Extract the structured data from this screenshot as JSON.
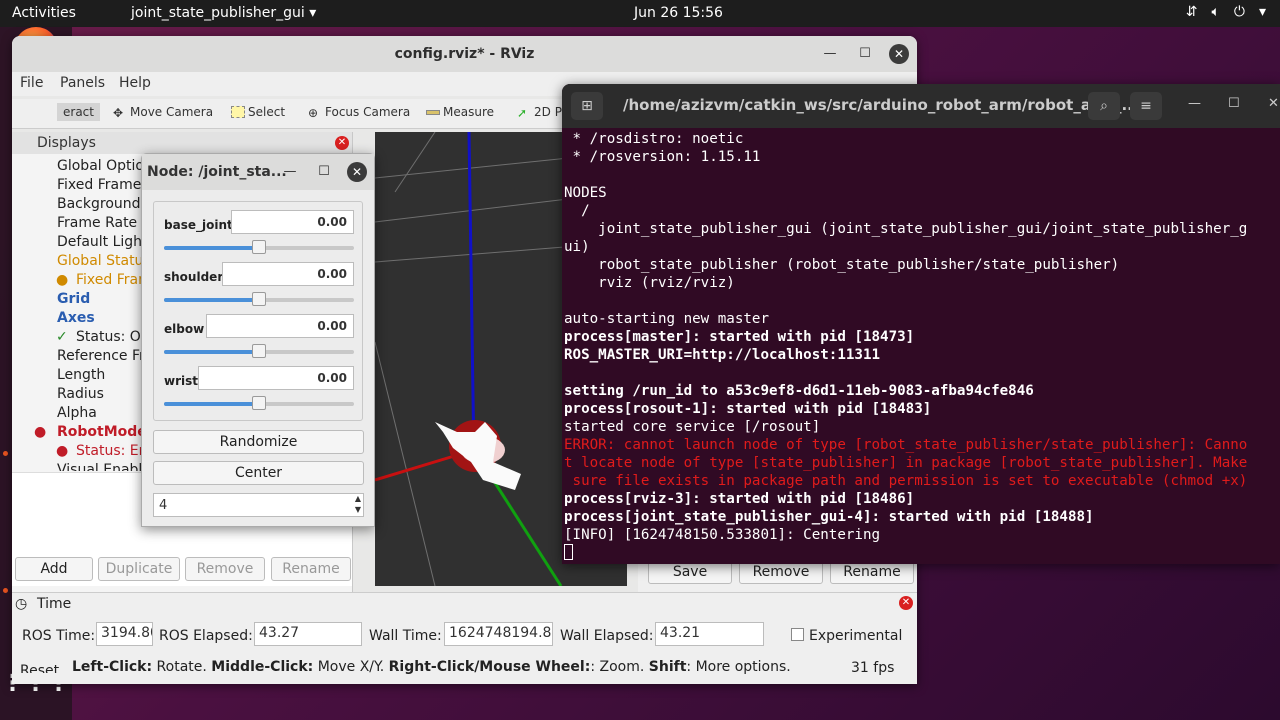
{
  "topbar": {
    "activities": "Activities",
    "app_name": "joint_state_publisher_gui",
    "clock": "Jun 26  15:56",
    "tray_icons": [
      "network-icon",
      "volume-icon",
      "power-icon",
      "chevron-down-icon"
    ]
  },
  "dock": {
    "apps": [
      "firefox-icon",
      "thunderbird-icon",
      "files-icon",
      "rhythmbox-icon",
      "writer-icon",
      "software-icon",
      "terminal-icon",
      "help-icon",
      "app-grid-icon"
    ]
  },
  "rviz": {
    "title": "config.rviz* - RViz",
    "menu": [
      "File",
      "Panels",
      "Help"
    ],
    "tools": [
      "eract",
      "Move Camera",
      "Select",
      "Focus Camera",
      "Measure",
      "2D Pe"
    ],
    "displays_header": "Displays",
    "display_items": [
      "Global Optio",
      "Fixed Frame",
      "Background",
      "Frame Rate",
      "Default Light",
      "Global Status",
      "Fixed Fran",
      "Grid",
      "Axes",
      "Status: Ol",
      "Reference Fr",
      "Length",
      "Radius",
      "Alpha",
      "RobotMode",
      "Status: Er",
      "Visual Enable"
    ],
    "buttons": {
      "add": "Add",
      "duplicate": "Duplicate",
      "remove": "Remove",
      "rename": "Rename"
    },
    "views_buttons": {
      "save": "Save",
      "remove": "Remove",
      "rename": "Rename"
    },
    "time_panel": {
      "header": "Time",
      "ros_time_label": "ROS Time:",
      "ros_time": "3194.80",
      "ros_elapsed_label": "ROS Elapsed:",
      "ros_elapsed": "43.27",
      "wall_time_label": "Wall Time:",
      "wall_time": "1624748194.84",
      "wall_elapsed_label": "Wall Elapsed:",
      "wall_elapsed": "43.21",
      "experimental_label": "Experimental",
      "reset": "Reset"
    },
    "status_bar": {
      "left_click": "Left-Click:",
      "rotate": "Rotate.",
      "middle_click": "Middle-Click:",
      "move": "Move X/Y.",
      "right_click": "Right-Click/Mouse Wheel:",
      "zoom": ": Zoom.",
      "shift": "Shift",
      "more": ": More options.",
      "fps": "31 fps"
    }
  },
  "node_dialog": {
    "title": "Node: /joint_sta...",
    "joints": [
      {
        "name": "base_joint",
        "value": "0.00",
        "position": 0.5
      },
      {
        "name": "shoulder",
        "value": "0.00",
        "position": 0.5
      },
      {
        "name": "elbow",
        "value": "0.00",
        "position": 0.5
      },
      {
        "name": "wrist",
        "value": "0.00",
        "position": 0.5
      }
    ],
    "randomize": "Randomize",
    "center": "Center",
    "spin_value": "4"
  },
  "terminal": {
    "title": "/home/azizvm/catkin_ws/src/arduino_robot_arm/robot_arm_...",
    "lines": [
      {
        "text": " * /rosdistro: noetic",
        "style": ""
      },
      {
        "text": " * /rosversion: 1.15.11",
        "style": ""
      },
      {
        "text": "",
        "style": ""
      },
      {
        "text": "NODES",
        "style": ""
      },
      {
        "text": "  /",
        "style": ""
      },
      {
        "text": "    joint_state_publisher_gui (joint_state_publisher_gui/joint_state_publisher_g",
        "style": ""
      },
      {
        "text": "ui)",
        "style": ""
      },
      {
        "text": "    robot_state_publisher (robot_state_publisher/state_publisher)",
        "style": ""
      },
      {
        "text": "    rviz (rviz/rviz)",
        "style": ""
      },
      {
        "text": "",
        "style": ""
      },
      {
        "text": "auto-starting new master",
        "style": ""
      },
      {
        "text": "process[master]: started with pid [18473]",
        "style": "bold"
      },
      {
        "text": "ROS_MASTER_URI=http://localhost:11311",
        "style": "bold"
      },
      {
        "text": "",
        "style": ""
      },
      {
        "text": "setting /run_id to a53c9ef8-d6d1-11eb-9083-afba94cfe846",
        "style": "bold"
      },
      {
        "text": "process[rosout-1]: started with pid [18483]",
        "style": "bold"
      },
      {
        "text": "started core service [/rosout]",
        "style": ""
      },
      {
        "text": "ERROR: cannot launch node of type [robot_state_publisher/state_publisher]: Canno",
        "style": "err"
      },
      {
        "text": "t locate node of type [state_publisher] in package [robot_state_publisher]. Make",
        "style": "err"
      },
      {
        "text": " sure file exists in package path and permission is set to executable (chmod +x)",
        "style": "err"
      },
      {
        "text": "process[rviz-3]: started with pid [18486]",
        "style": "bold"
      },
      {
        "text": "process[joint_state_publisher_gui-4]: started with pid [18488]",
        "style": "bold"
      },
      {
        "text": "[INFO] [1624748150.533801]: Centering",
        "style": ""
      }
    ]
  }
}
